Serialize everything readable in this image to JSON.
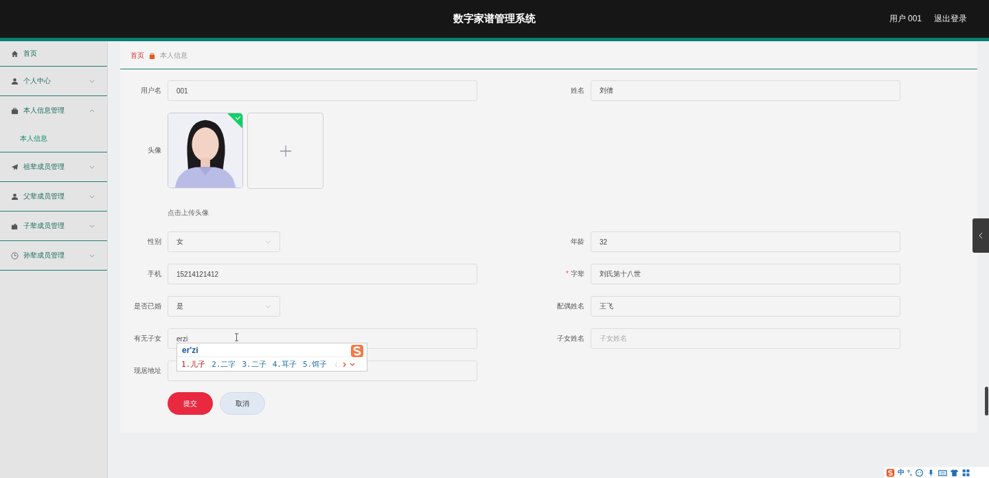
{
  "header": {
    "title": "数字家谱管理系统",
    "user": "用户 001",
    "logout": "退出登录"
  },
  "sidebar": {
    "items": [
      {
        "label": "首页",
        "kind": "link"
      },
      {
        "label": "个人中心",
        "kind": "menu",
        "expanded": false
      },
      {
        "label": "本人信息管理",
        "kind": "menu",
        "expanded": true,
        "children": [
          {
            "label": "本人信息",
            "selected": true
          }
        ]
      },
      {
        "label": "祖辈成员管理",
        "kind": "menu",
        "expanded": false
      },
      {
        "label": "父辈成员管理",
        "kind": "menu",
        "expanded": false
      },
      {
        "label": "子辈成员管理",
        "kind": "menu",
        "expanded": false
      },
      {
        "label": "孙辈成员管理",
        "kind": "menu",
        "expanded": false
      }
    ]
  },
  "breadcrumb": [
    {
      "label": "首页",
      "kind": "link"
    },
    {
      "label": "本人信息",
      "kind": "current"
    }
  ],
  "form": {
    "rows": [
      {
        "fields": [
          {
            "kind": "text",
            "label": "用户名",
            "value": "001"
          },
          {
            "kind": "text",
            "label": "姓名",
            "value": "刘倩"
          }
        ]
      },
      {
        "fields": [
          {
            "kind": "upload",
            "label": "头像",
            "uploaded": true
          }
        ]
      },
      {
        "fields": [
          {
            "kind": "note",
            "text": "点击上传头像"
          }
        ]
      },
      {
        "fields": [
          {
            "kind": "select",
            "label": "性别",
            "value": "女"
          },
          {
            "kind": "text",
            "label": "年龄",
            "value": "32"
          }
        ]
      },
      {
        "fields": [
          {
            "kind": "text",
            "label": "手机",
            "value": "15214121412"
          },
          {
            "kind": "text",
            "label": "字辈",
            "value": "刘氏第十八世",
            "required_mark": "*"
          }
        ]
      },
      {
        "fields": [
          {
            "kind": "select",
            "label": "是否已婚",
            "value": "是"
          },
          {
            "kind": "text",
            "label": "配偶姓名",
            "value": "王飞"
          }
        ]
      },
      {
        "fields": [
          {
            "kind": "text",
            "label": "有无子女",
            "value": "erzi",
            "ime": {
              "composition": "er'zi",
              "candidates": [
                {
                  "text": "1.儿子",
                  "selected": true
                },
                {
                  "text": "2.二字",
                  "selected": false
                },
                {
                  "text": "3.二子",
                  "selected": false
                },
                {
                  "text": "4.耳子",
                  "selected": false
                },
                {
                  "text": "5.饵子",
                  "selected": false
                }
              ]
            }
          },
          {
            "kind": "text",
            "label": "子女姓名",
            "placeholder": "子女姓名"
          }
        ]
      },
      {
        "fields": [
          {
            "kind": "text",
            "label": "现居地址"
          }
        ]
      }
    ],
    "buttons": [
      {
        "label": "提交",
        "kind": "primary"
      },
      {
        "label": "取消",
        "kind": "secondary"
      }
    ]
  },
  "ime_status": {
    "mode": "中",
    "punctuation": "°,"
  }
}
